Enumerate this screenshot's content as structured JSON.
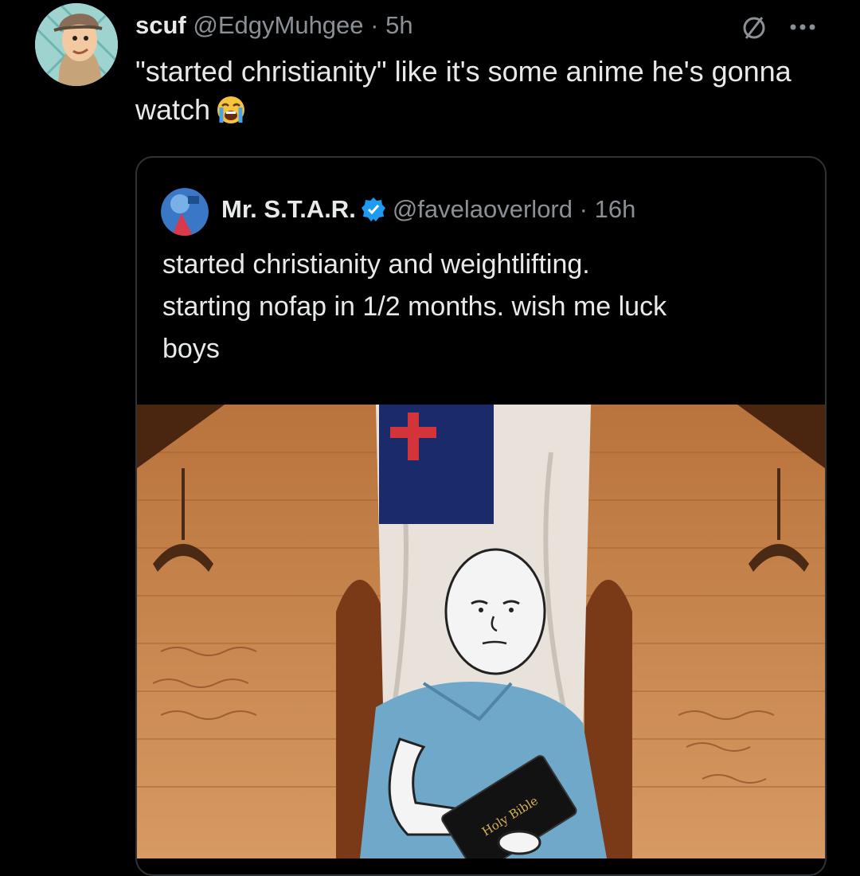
{
  "tweet": {
    "display_name": "scuf",
    "handle": "@EdgyMuhgee",
    "separator": "·",
    "time": "5h",
    "text": "\"started christianity\" like it's some anime he's gonna watch",
    "emoji_icon": "loudly-crying-face-emoji",
    "header_icons": [
      "no-sign-icon",
      "more-options-icon"
    ]
  },
  "quoted_tweet": {
    "display_name": "Mr. S.T.A.R.",
    "verified": true,
    "handle": "@favelaoverlord",
    "separator": "·",
    "time": "16h",
    "text_lines": [
      "started christianity and weightlifting.",
      "starting nofap in 1/2 months. wish me luck",
      "boys"
    ],
    "media_book_text": "Holy Bible"
  },
  "colors": {
    "background": "#000000",
    "text": "#e7e9ea",
    "secondary": "#8b9096",
    "border": "#2f3336",
    "verified": "#1d9bf0"
  }
}
